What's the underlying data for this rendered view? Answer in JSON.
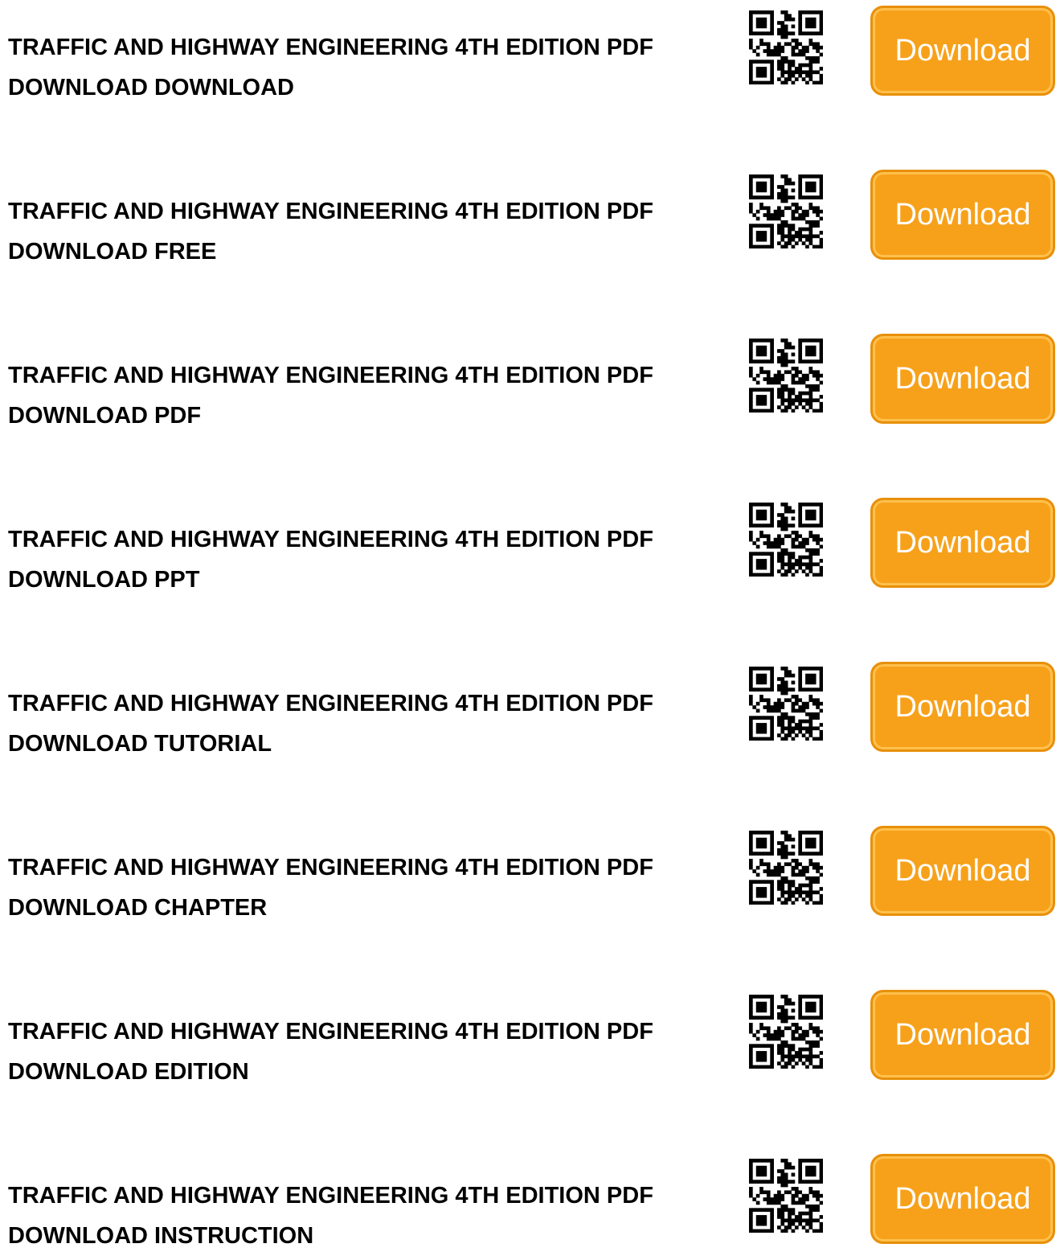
{
  "button_color": "#f7a11b",
  "qr_icon": "qr-code-icon",
  "items": [
    {
      "title_line1": "TRAFFIC AND HIGHWAY ENGINEERING 4TH EDITION PDF",
      "title_line2": "DOWNLOAD DOWNLOAD",
      "button_label": "Download"
    },
    {
      "title_line1": "TRAFFIC AND HIGHWAY ENGINEERING 4TH EDITION PDF",
      "title_line2": "DOWNLOAD FREE",
      "button_label": "Download"
    },
    {
      "title_line1": "TRAFFIC AND HIGHWAY ENGINEERING 4TH EDITION PDF",
      "title_line2": "DOWNLOAD PDF",
      "button_label": "Download"
    },
    {
      "title_line1": "TRAFFIC AND HIGHWAY ENGINEERING 4TH EDITION PDF",
      "title_line2": "DOWNLOAD PPT",
      "button_label": "Download"
    },
    {
      "title_line1": "TRAFFIC AND HIGHWAY ENGINEERING 4TH EDITION PDF",
      "title_line2": "DOWNLOAD TUTORIAL",
      "button_label": "Download"
    },
    {
      "title_line1": "TRAFFIC AND HIGHWAY ENGINEERING 4TH EDITION PDF",
      "title_line2": "DOWNLOAD CHAPTER",
      "button_label": "Download"
    },
    {
      "title_line1": "TRAFFIC AND HIGHWAY ENGINEERING 4TH EDITION PDF",
      "title_line2": "DOWNLOAD EDITION",
      "button_label": "Download"
    },
    {
      "title_line1": "TRAFFIC AND HIGHWAY ENGINEERING 4TH EDITION PDF",
      "title_line2": "DOWNLOAD INSTRUCTION",
      "button_label": "Download"
    }
  ]
}
